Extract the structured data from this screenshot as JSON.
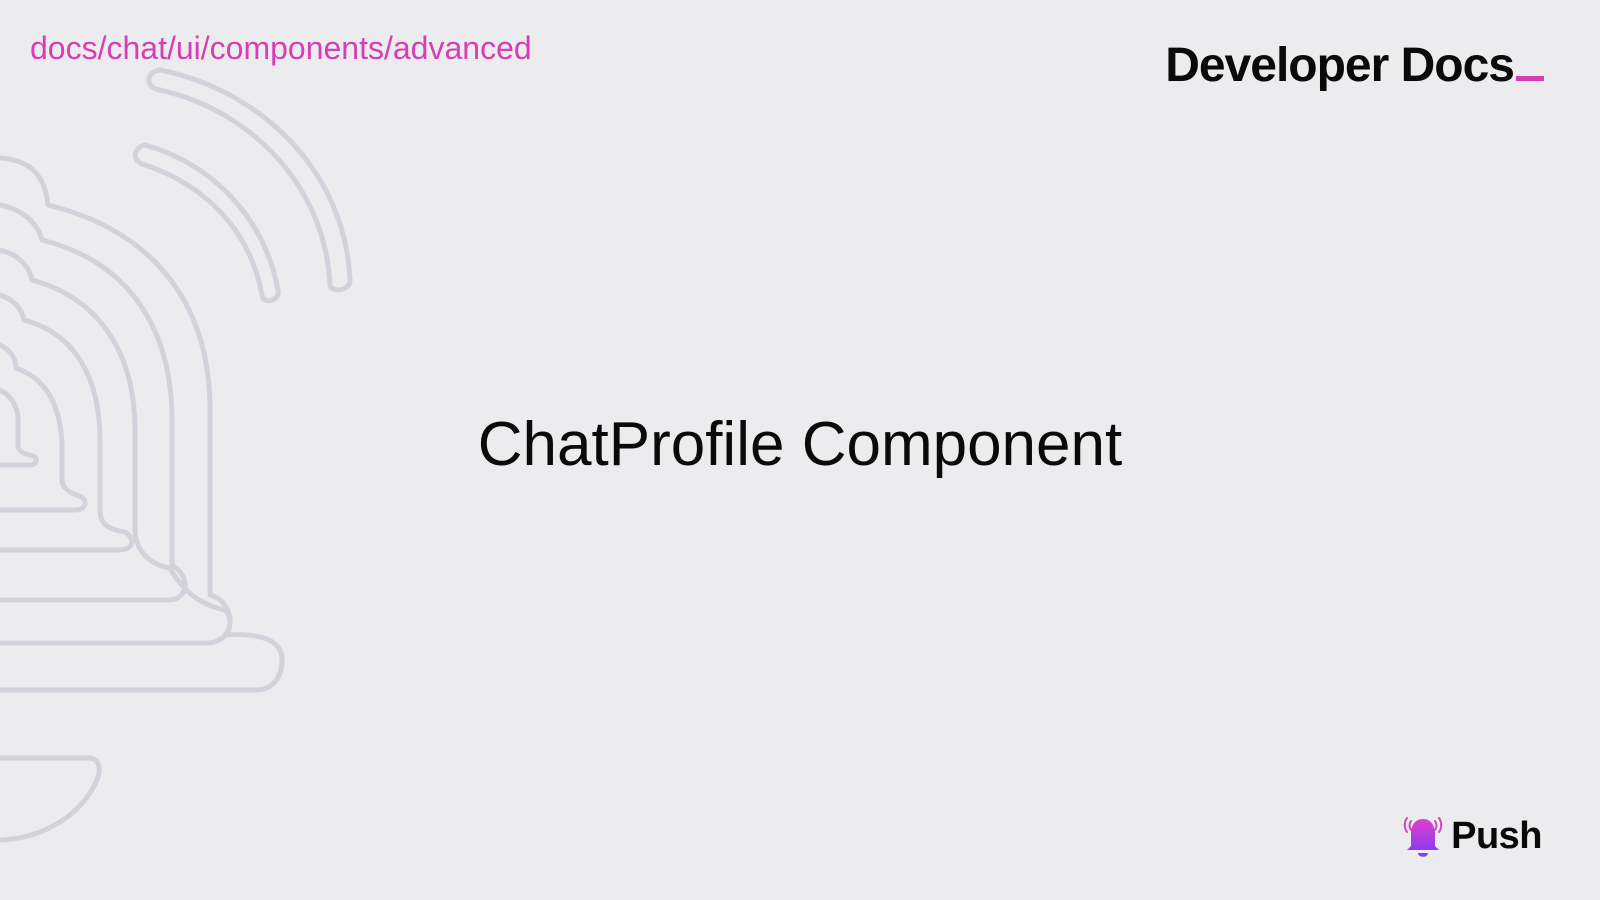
{
  "header": {
    "breadcrumb": "docs/chat/ui/components/advanced",
    "brand_title": "Developer Docs"
  },
  "main": {
    "title": "ChatProfile Component"
  },
  "footer": {
    "logo_text": "Push"
  },
  "colors": {
    "background": "#ececee",
    "accent": "#d63fb4",
    "outline_art": "#d3d2db",
    "text": "#0a0a0a"
  },
  "icons": {
    "background_art": "bell-outline-icon",
    "logo_bell": "bell-icon"
  }
}
